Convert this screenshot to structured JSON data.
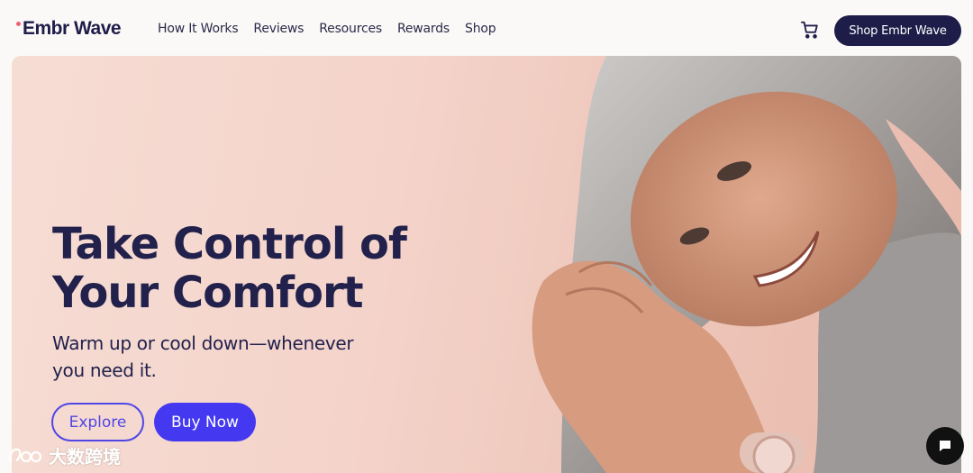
{
  "header": {
    "logo_text": "Embr Wave",
    "nav": [
      "How It Works",
      "Reviews",
      "Resources",
      "Rewards",
      "Shop"
    ],
    "cart_icon": "cart-icon",
    "cta_label": "Shop Embr Wave"
  },
  "hero": {
    "title_line1": "Take Control of",
    "title_line2": "Your Comfort",
    "subtitle_line1": "Warm up or cool down—whenever",
    "subtitle_line2": "you need it.",
    "explore_label": "Explore",
    "buy_label": "Buy Now",
    "photo": "smiling woman with gray hair wearing Embr Wave bracelet"
  },
  "watermark": {
    "text": "大数跨境"
  },
  "chat_icon": "chat-bubble-icon",
  "colors": {
    "navy": "#1e1d4a",
    "accent": "#4438f0",
    "hero_bg": "#f4d3ca"
  }
}
